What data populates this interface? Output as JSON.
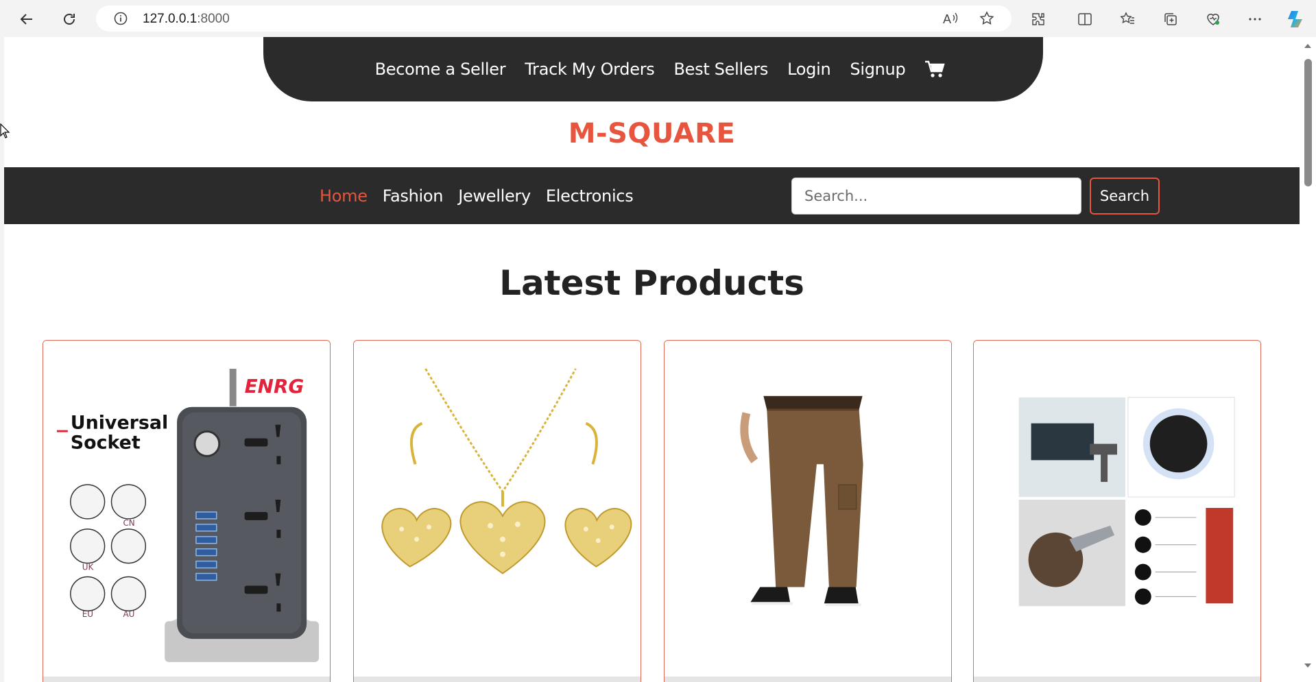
{
  "browser": {
    "url_host": "127.0.0.1",
    "url_port": ":8000"
  },
  "top_nav": {
    "items": [
      "Become a Seller",
      "Track My Orders",
      "Best Sellers",
      "Login",
      "Signup"
    ],
    "cart_icon": "cart-icon"
  },
  "brand": "M-SQUARE",
  "category_nav": {
    "items": [
      "Home",
      "Fashion",
      "Jewellery",
      "Electronics"
    ],
    "active": "Home"
  },
  "search": {
    "placeholder": "Search...",
    "button_label": "Search"
  },
  "section_title": "Latest Products",
  "products": [
    {
      "image": "universal-socket-image",
      "overlay_text_line1": "Universal",
      "overlay_text_line2": "Socket",
      "brand_text": "ENRG",
      "plug_labels": [
        "CN",
        "UK",
        "EU",
        "AU"
      ]
    },
    {
      "image": "heart-jewellery-set-image"
    },
    {
      "image": "brown-cargo-pants-image"
    },
    {
      "image": "massage-gun-image"
    }
  ],
  "colors": {
    "accent": "#e8553e",
    "dark": "#2b2b2b"
  }
}
